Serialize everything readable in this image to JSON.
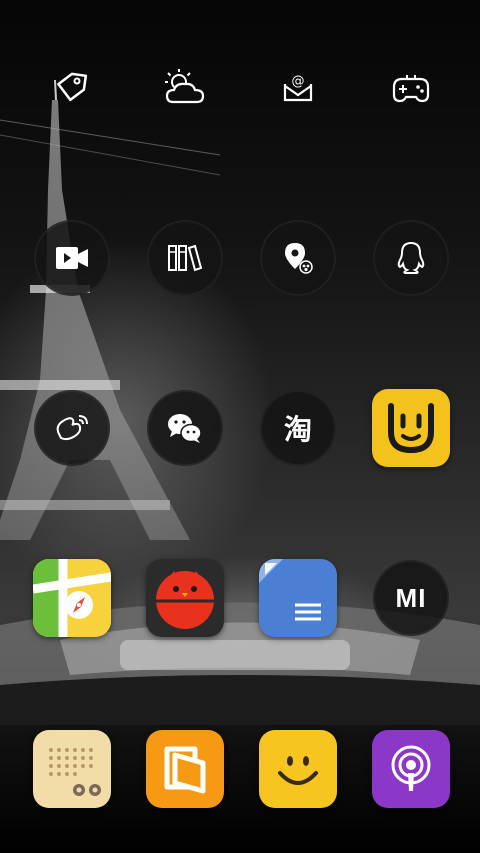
{
  "wallpaper": {
    "theme": "night-paris-eiffel-tower-monochrome"
  },
  "home_screen": {
    "rows": [
      {
        "icons": [
          {
            "name": "tag-icon",
            "style": "outline"
          },
          {
            "name": "weather-icon",
            "style": "outline"
          },
          {
            "name": "mail-icon",
            "style": "outline"
          },
          {
            "name": "gamepad-icon",
            "style": "outline"
          }
        ]
      },
      {
        "icons": [
          {
            "name": "video-icon",
            "style": "circle"
          },
          {
            "name": "file-manager-icon",
            "style": "circle"
          },
          {
            "name": "map-pin-icon",
            "style": "circle"
          },
          {
            "name": "qq-icon",
            "style": "circle"
          }
        ]
      },
      {
        "icons": [
          {
            "name": "weibo-icon",
            "style": "circle"
          },
          {
            "name": "wechat-icon",
            "style": "circle"
          },
          {
            "name": "taobao-icon",
            "style": "circle",
            "text": "淘"
          },
          {
            "name": "smile-u-icon",
            "style": "tile",
            "color": "#f4c21c"
          }
        ]
      },
      {
        "icons": [
          {
            "name": "maps-compass-icon",
            "style": "tile",
            "color": "#7bc043"
          },
          {
            "name": "red-bird-icon",
            "style": "tile",
            "color": "#e8321e"
          },
          {
            "name": "docs-icon",
            "style": "tile",
            "color": "#4a7fd4"
          },
          {
            "name": "mi-icon",
            "style": "circle",
            "text": "MI"
          }
        ]
      }
    ]
  },
  "dock": {
    "icons": [
      {
        "name": "radio-icon",
        "color": "#f2dca8"
      },
      {
        "name": "wallet-icon",
        "color": "#f59a12"
      },
      {
        "name": "smiley-icon",
        "color": "#f7c520"
      },
      {
        "name": "podcast-icon",
        "color": "#8b38c8"
      }
    ]
  }
}
